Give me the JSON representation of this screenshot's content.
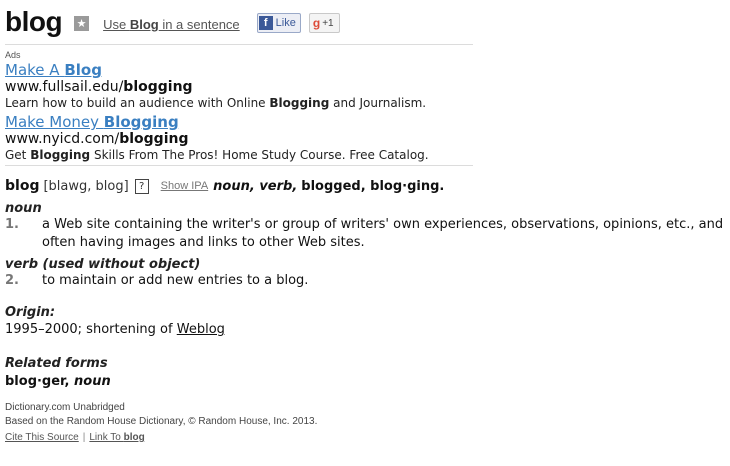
{
  "header": {
    "word": "blog",
    "star_icon": "star-icon",
    "use_link": {
      "prefix": "Use ",
      "word": "Blog",
      "suffix": " in a sentence"
    },
    "facebook": {
      "icon": "facebook-icon",
      "icon_glyph": "f",
      "label": "Like"
    },
    "google": {
      "icon": "google-plus-icon",
      "icon_glyph": "g",
      "label": "+1"
    }
  },
  "ads": {
    "label": "Ads",
    "items": [
      {
        "title_plain": "Make A ",
        "title_bold": "Blog",
        "url_plain": "www.fullsail.edu/",
        "url_bold": "blogging",
        "desc_before": "Learn how to build an audience with Online ",
        "desc_bold": "Blogging",
        "desc_after": " and Journalism."
      },
      {
        "title_plain": "Make Money ",
        "title_bold": "Blogging",
        "url_plain": "www.nyicd.com/",
        "url_bold": "blogging",
        "desc_before": "Get ",
        "desc_bold": "Blogging",
        "desc_after": " Skills From The Pros! Home Study Course. Free Catalog."
      }
    ]
  },
  "entry": {
    "headword": "blog",
    "spelling": "[blawg, blog]",
    "help_icon": "?",
    "show_ipa": "Show IPA",
    "pos_inline": "noun, verb,",
    "forms_inline": "blogged, blog·ging."
  },
  "definitions": {
    "noun_label": "noun",
    "noun_num": "1.",
    "noun_text": "a Web site containing the writer's or group of writers' own experiences, observations, opinions, etc., and often having images and links to other Web sites.",
    "verb_label": "verb (used without object)",
    "verb_num": "2.",
    "verb_text": "to maintain or add new entries to a blog."
  },
  "origin": {
    "label": "Origin:",
    "text": "1995–2000;  shortening of ",
    "link": "Weblog"
  },
  "related": {
    "label": "Related forms",
    "form": "blog·ger,",
    "pos": "noun"
  },
  "source": {
    "name": "Dictionary.com Unabridged",
    "credit": "Based on the Random House Dictionary, © Random House, Inc. 2013.",
    "cite_link": "Cite This Source",
    "separator": "|",
    "link_to_prefix": "Link To ",
    "link_to_word": "blog"
  }
}
